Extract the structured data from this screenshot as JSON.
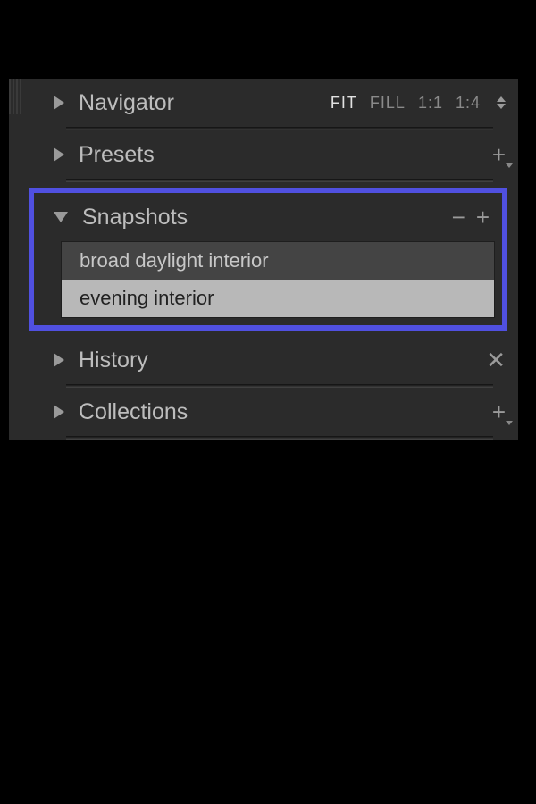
{
  "panels": {
    "navigator": {
      "title": "Navigator"
    },
    "presets": {
      "title": "Presets"
    },
    "snapshots": {
      "title": "Snapshots",
      "items": [
        {
          "label": "broad daylight interior",
          "selected": false
        },
        {
          "label": "evening interior",
          "selected": true
        }
      ]
    },
    "history": {
      "title": "History"
    },
    "collections": {
      "title": "Collections"
    }
  },
  "navigator_zoom": {
    "fit": "FIT",
    "fill": "FILL",
    "one": "1:1",
    "quarter": "1:4"
  }
}
